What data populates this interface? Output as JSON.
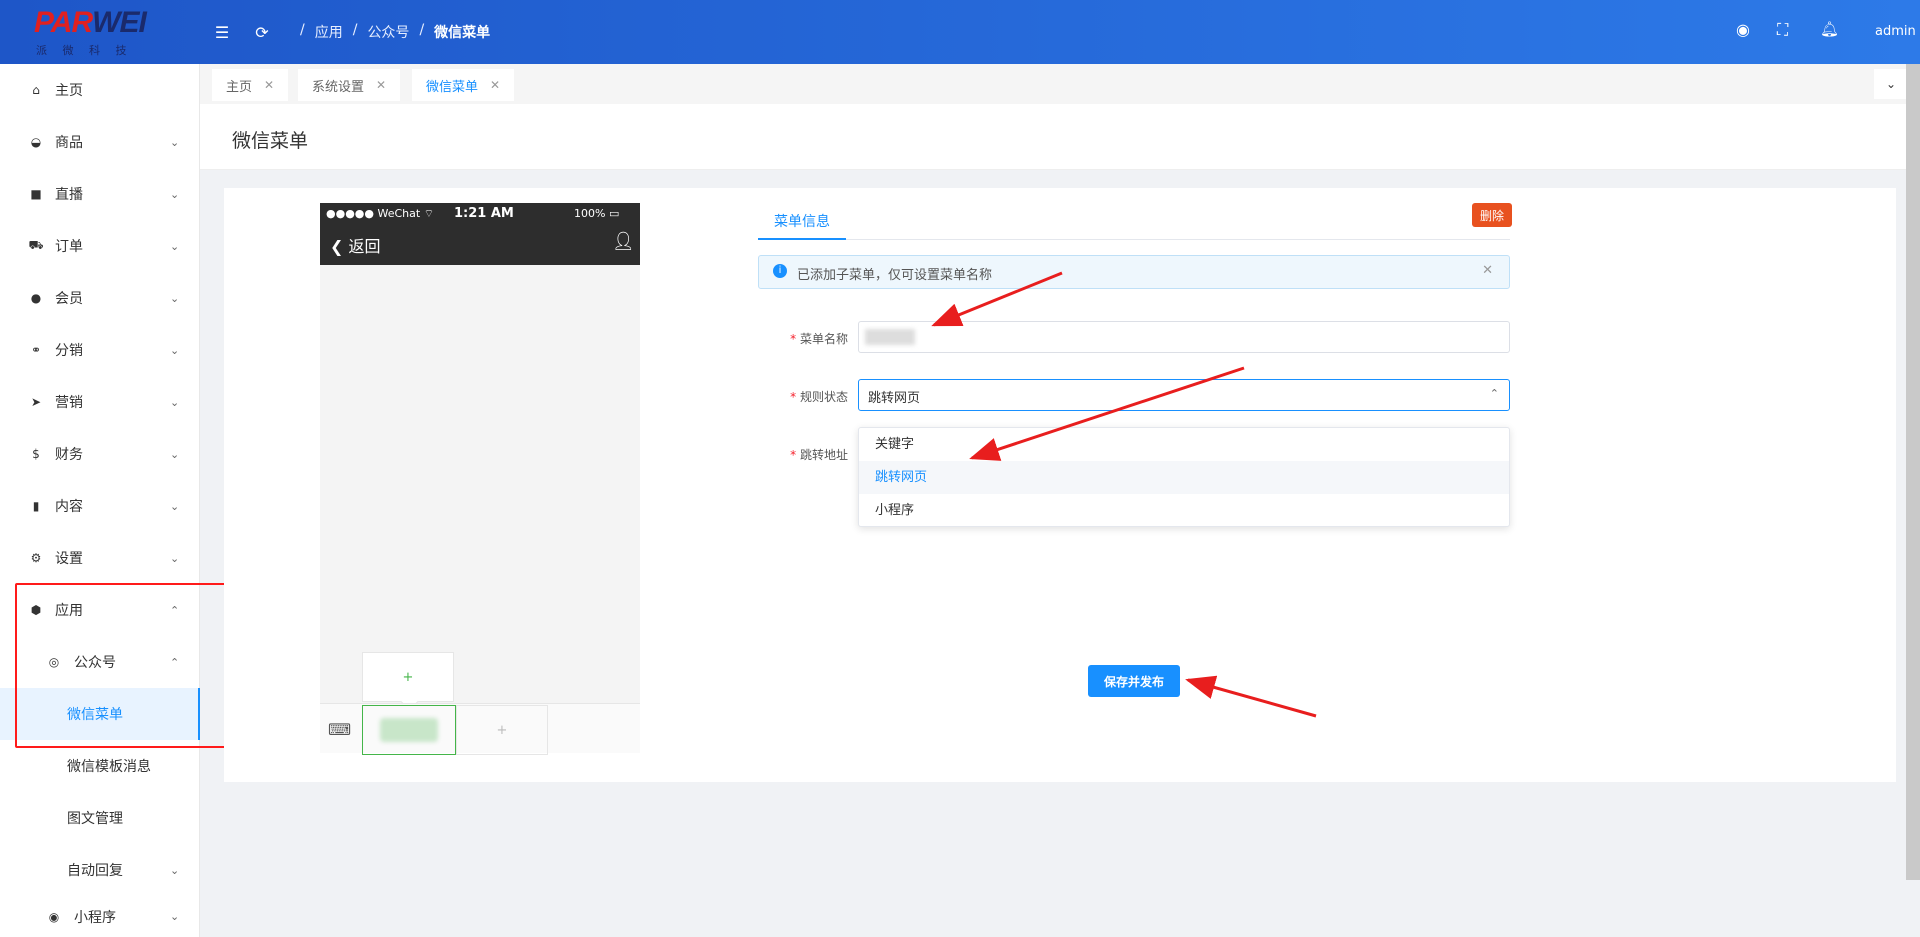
{
  "header": {
    "logo_text_red": "PAR",
    "logo_text_blue": "WEI",
    "logo_sub": "派 微 科 技",
    "breadcrumb": [
      "应用",
      "公众号",
      "微信菜单"
    ],
    "user": "admin"
  },
  "sidebar": {
    "items": [
      {
        "label": "主页",
        "icon": "home-icon"
      },
      {
        "label": "商品",
        "icon": "basket-icon"
      },
      {
        "label": "直播",
        "icon": "video-icon"
      },
      {
        "label": "订单",
        "icon": "cart-icon"
      },
      {
        "label": "会员",
        "icon": "user-icon"
      },
      {
        "label": "分销",
        "icon": "share-icon"
      },
      {
        "label": "营销",
        "icon": "send-icon"
      },
      {
        "label": "财务",
        "icon": "dollar-icon"
      },
      {
        "label": "内容",
        "icon": "book-icon"
      },
      {
        "label": "设置",
        "icon": "gear-icon"
      },
      {
        "label": "应用",
        "icon": "cube-icon"
      },
      {
        "label": "公众号",
        "icon": "target-icon"
      },
      {
        "label": "微信菜单"
      },
      {
        "label": "微信模板消息"
      },
      {
        "label": "图文管理"
      },
      {
        "label": "自动回复"
      },
      {
        "label": "小程序",
        "icon": "target-icon"
      }
    ]
  },
  "tabs": [
    {
      "label": "主页"
    },
    {
      "label": "系统设置"
    },
    {
      "label": "微信菜单"
    }
  ],
  "page": {
    "title": "微信菜单"
  },
  "phone": {
    "status_left": "●●●●● WeChat ⌔",
    "status_time": "1:21 AM",
    "status_right": "100%",
    "back": "返回",
    "plus": "+"
  },
  "form": {
    "tab": "菜单信息",
    "delete": "删除",
    "alert": "已添加子菜单，仅可设置菜单名称",
    "name_label": "菜单名称",
    "rule_label": "规则状态",
    "rule_value": "跳转网页",
    "url_label": "跳转地址",
    "options": [
      "关键字",
      "跳转网页",
      "小程序"
    ],
    "save": "保存并发布"
  },
  "colors": {
    "primary": "#1890ff",
    "header": "#2a6fe0",
    "danger": "#e8511f",
    "wechat_green": "#44b549"
  }
}
